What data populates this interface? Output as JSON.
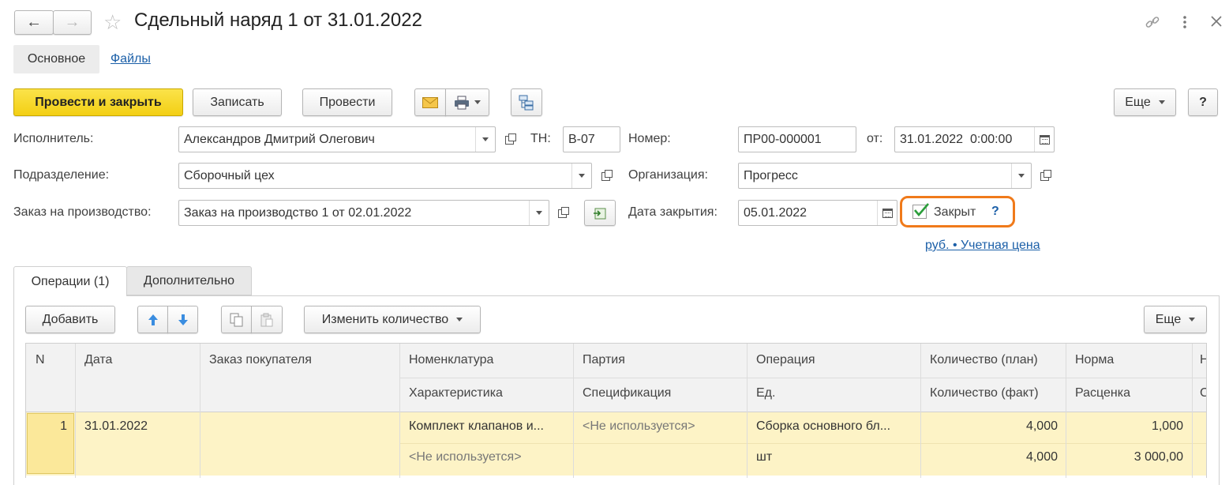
{
  "window": {
    "title": "Сдельный наряд 1 от 31.01.2022",
    "nav_back": "←",
    "nav_forward": "→"
  },
  "sections": [
    {
      "label": "Основное",
      "active": true
    },
    {
      "label": "Файлы",
      "active": false
    }
  ],
  "toolbar": {
    "post_close": "Провести и закрыть",
    "save": "Записать",
    "post": "Провести",
    "more": "Еще",
    "help": "?"
  },
  "form": {
    "executor_label": "Исполнитель:",
    "executor_value": "Александров Дмитрий Олегович",
    "tn_label": "ТН:",
    "tn_value": "В-07",
    "number_label": "Номер:",
    "number_value": "ПР00-000001",
    "from_label": "от:",
    "date_value": "31.01.2022  0:00:00",
    "division_label": "Подразделение:",
    "division_value": "Сборочный цех",
    "org_label": "Организация:",
    "org_value": "Прогресс",
    "order_label": "Заказ на производство:",
    "order_value": "Заказ на производство 1 от 02.01.2022",
    "close_date_label": "Дата закрытия:",
    "close_date_value": "05.01.2022",
    "closed_label": "Закрыт",
    "closed_checked": true,
    "closed_help": "?",
    "price_link": "руб. • Учетная цена"
  },
  "tabs": [
    {
      "label": "Операции (1)",
      "active": true
    },
    {
      "label": "Дополнительно",
      "active": false
    }
  ],
  "table_toolbar": {
    "add": "Добавить",
    "change_qty": "Изменить количество",
    "more": "Еще"
  },
  "table": {
    "headers_row1": [
      "N",
      "Дата",
      "Заказ покупателя",
      "Номенклатура",
      "Партия",
      "Операция",
      "Количество (план)",
      "Норма",
      "Н"
    ],
    "headers_row2": [
      "",
      "",
      "",
      "Характеристика",
      "Спецификация",
      "Ед.",
      "Количество (факт)",
      "Расценка",
      "С"
    ],
    "rows": [
      {
        "n": "1",
        "date": "31.01.2022",
        "customer_order": "",
        "nomenclature": "Комплект клапанов и...",
        "batch": "<Не используется>",
        "operation": "Сборка основного бл...",
        "qty_plan": "4,000",
        "norm": "1,000",
        "characteristic": "<Не используется>",
        "specification": "",
        "unit": "шт",
        "qty_fact": "4,000",
        "rate": "3 000,00"
      }
    ]
  },
  "colors": {
    "accent_yellow": "#f5d41f",
    "highlight_orange": "#f07a1a",
    "selected_row": "#fdf3c6",
    "link": "#1b5fa8",
    "check_green": "#2a9d3a"
  }
}
